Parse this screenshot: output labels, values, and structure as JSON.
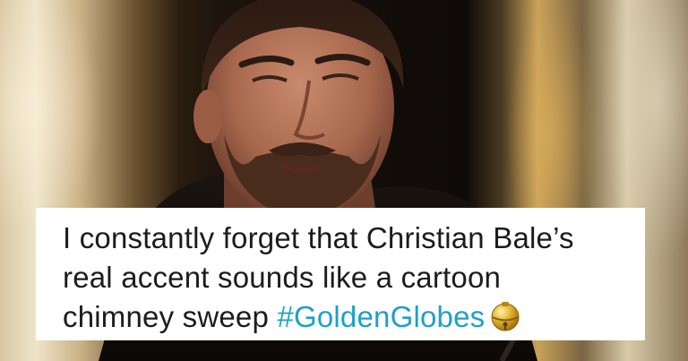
{
  "caption": {
    "line1": "I constantly forget that Christian Bale’s",
    "line2": "real accent sounds like a cartoon",
    "line3_text": "chimney sweep ",
    "line3_hashtag": "#GoldenGlobes",
    "emoji": "bell-emoji"
  },
  "colors": {
    "caption_background": "#ffffff",
    "caption_text": "#1c1c1c",
    "hashtag": "#1fa0c9",
    "bell": "#d8a928"
  }
}
